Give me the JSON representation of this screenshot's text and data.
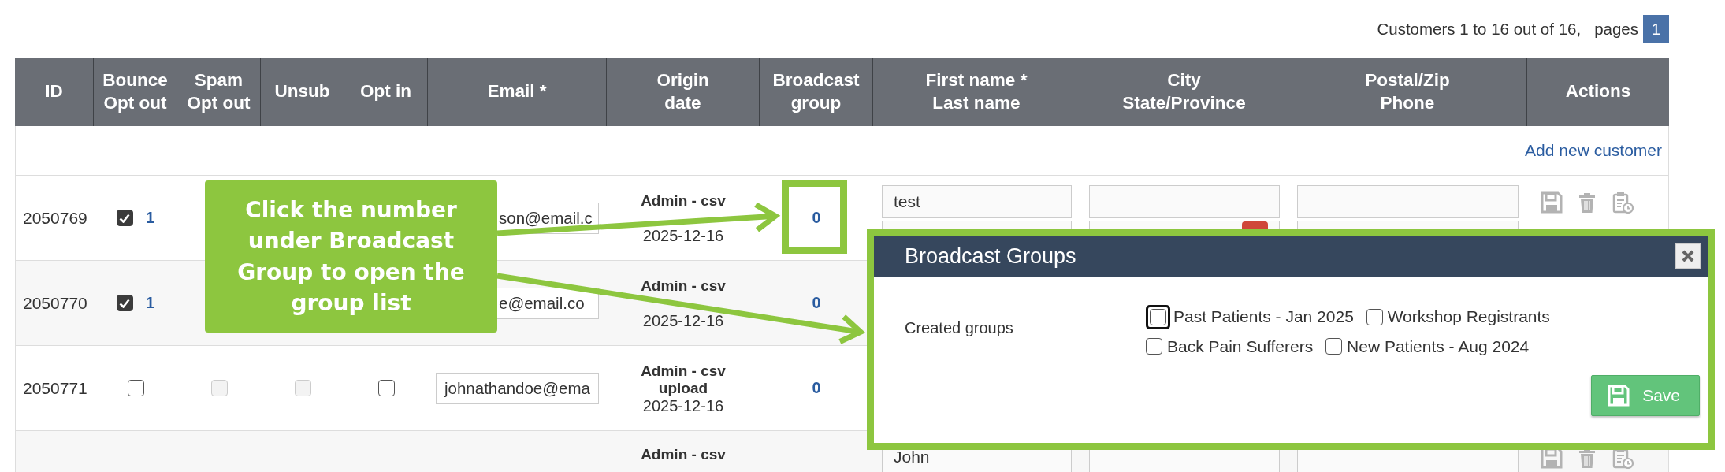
{
  "pagination": {
    "summary": "Customers 1 to 16 out of 16,",
    "label": "pages",
    "pages": [
      {
        "label": "1",
        "selected": true
      }
    ]
  },
  "table": {
    "columns": [
      "ID",
      "Bounce\nOpt out",
      "Spam\nOpt out",
      "Unsub",
      "Opt in",
      "Email *",
      "Origin\ndate",
      "Broadcast\ngroup",
      "First name *\nLast name",
      "City\nState/Province",
      "Postal/Zip\nPhone",
      "Actions"
    ],
    "add_link": "Add new customer",
    "rows": [
      {
        "id": "2050769",
        "bounce": {
          "checked": true,
          "count": "1"
        },
        "email": {
          "value": "son@email.c",
          "covered": true
        },
        "origin": {
          "source": "Admin - csv",
          "date": "2025-12-16"
        },
        "broadcast": "0",
        "contact": {
          "first_name": "test",
          "second_line": true,
          "city_error": true
        }
      },
      {
        "id": "2050770",
        "bounce": {
          "checked": true,
          "count": "1"
        },
        "email": {
          "value": "e@email.co",
          "covered": true
        },
        "origin": {
          "source": "Admin - csv",
          "date": "2025-12-16"
        },
        "broadcast": "0"
      },
      {
        "id": "2050771",
        "bounce": {
          "checked": false
        },
        "spam": {
          "checked": false,
          "disabled": true
        },
        "unsub": {
          "checked": false,
          "disabled": true
        },
        "opt_in": {
          "checked": false,
          "disabled": false
        },
        "email": {
          "value": "johnathandoe@ema",
          "covered": false
        },
        "origin": {
          "source": "Admin - csv",
          "method": "upload",
          "date": "2025-12-16"
        },
        "broadcast": "0"
      },
      {
        "origin": {
          "source": "Admin - csv"
        },
        "contact": {
          "first_name": "John"
        }
      }
    ]
  },
  "callout": {
    "text": "Click the number under Broadcast Group to open the group list"
  },
  "dialog": {
    "title": "Broadcast Groups",
    "label": "Created groups",
    "groups": [
      {
        "label": "Past Patients - Jan 2025",
        "checked": false,
        "focused": true
      },
      {
        "label": "Workshop Registrants",
        "checked": false,
        "focused": false
      },
      {
        "label": "Back Pain Sufferers",
        "checked": false,
        "focused": false
      },
      {
        "label": "New Patients - Aug 2024",
        "checked": false,
        "focused": false
      }
    ],
    "save": "Save"
  }
}
